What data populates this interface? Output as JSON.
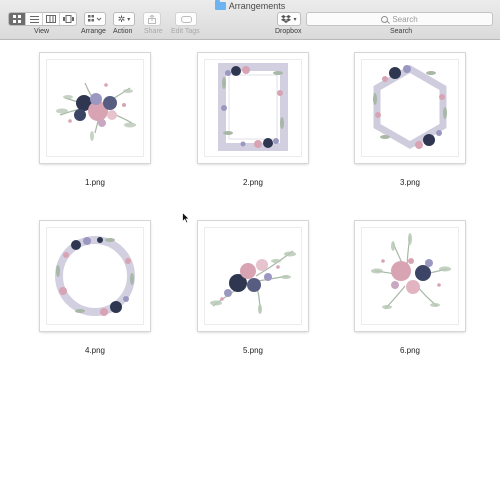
{
  "window": {
    "title": "Arrangements"
  },
  "toolbar": {
    "view_label": "View",
    "arrange_label": "Arrange",
    "action_label": "Action",
    "share_label": "Share",
    "edit_tags_label": "Edit Tags",
    "dropbox_label": "Dropbox",
    "search_label": "Search",
    "search_placeholder": "Search",
    "view_modes": [
      "icon-view",
      "list-view",
      "column-view",
      "gallery-view"
    ],
    "active_view": "icon-view"
  },
  "files": [
    {
      "name": "1.png",
      "art": "bouquet-center"
    },
    {
      "name": "2.png",
      "art": "rectangle-frame"
    },
    {
      "name": "3.png",
      "art": "hexagon-frame"
    },
    {
      "name": "4.png",
      "art": "circle-wreath"
    },
    {
      "name": "5.png",
      "art": "bouquet-diagonal"
    },
    {
      "name": "6.png",
      "art": "bouquet-upright"
    }
  ],
  "colors": {
    "navy": "#2f3650",
    "rose": "#d8a3b3",
    "lavender": "#9a98c0",
    "sage": "#9fb2a2"
  }
}
